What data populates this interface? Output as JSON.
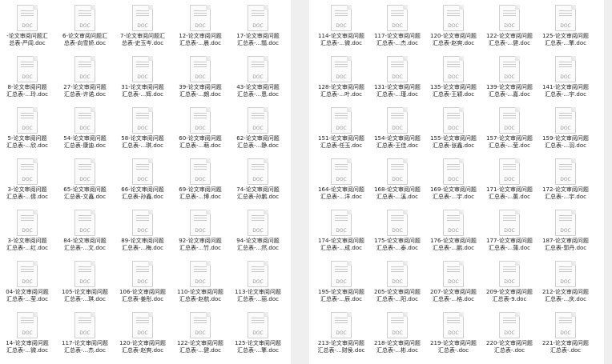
{
  "icon_tag": "DOC",
  "left_panel": {
    "items": [
      {
        "l1": "-论文审阅问题汇",
        "l2": "总表-严闾.doc"
      },
      {
        "l1": "6-论文审阅问题汇",
        "l2": "总表-向雪娇.doc"
      },
      {
        "l1": "7-论文审阅问题汇",
        "l2": "总表-史玉岑.doc"
      },
      {
        "l1": "12-论文审阅问题",
        "l2": "汇总表-...晨.doc"
      },
      {
        "l1": "17-论文审阅问题",
        "l2": "汇总表-...瓢.doc"
      },
      {
        "l1": "8-论文审阅问题",
        "l2": "汇总表-...玲.doc"
      },
      {
        "l1": "27-论文审阅问题",
        "l2": "汇总表-许诺.doc"
      },
      {
        "l1": "31-论文审阅问题",
        "l2": "汇总表-...辉.doc"
      },
      {
        "l1": "39-论文审阅问题",
        "l2": "汇总表-...朗.doc"
      },
      {
        "l1": "43-论文审阅问题",
        "l2": "汇总表-...恩.doc"
      },
      {
        "l1": "5-论文审阅问题",
        "l2": "汇总表-...欣.doc"
      },
      {
        "l1": "54-论文审阅问题",
        "l2": "汇总表-康迪.doc"
      },
      {
        "l1": "58-论文审阅问题",
        "l2": "汇总表-...琪.doc"
      },
      {
        "l1": "60-论文审阅问题",
        "l2": "汇总表-...萌.doc"
      },
      {
        "l1": "62-论文审阅问题",
        "l2": "汇总表-...静.doc"
      },
      {
        "l1": "3-论文审阅问题",
        "l2": "汇总表-...倩.doc"
      },
      {
        "l1": "65-论文审阅问题",
        "l2": "汇总表-文鑫.doc"
      },
      {
        "l1": "66-论文审阅问题",
        "l2": "汇总表-孙鑫.doc"
      },
      {
        "l1": "69-论文审阅问题",
        "l2": "汇总表-...博.doc"
      },
      {
        "l1": "74-论文审阅问题",
        "l2": "汇总表-孙鹏.doc"
      },
      {
        "l1": "3-论文审阅问题",
        "l2": "汇总表-...红.doc"
      },
      {
        "l1": "84-论文审阅问题",
        "l2": "汇总表-...文.doc"
      },
      {
        "l1": "89-论文审阅问题",
        "l2": "汇总表-...梅.doc"
      },
      {
        "l1": "92-论文审阅问题",
        "l2": "汇总表-...竹.doc"
      },
      {
        "l1": "94-论文审阅问题",
        "l2": "汇总表-...然.doc"
      },
      {
        "l1": "04-论文审阅问题",
        "l2": "汇总表-...莹.doc"
      },
      {
        "l1": "105-论文审阅问题",
        "l2": "汇总表-...琪.doc"
      },
      {
        "l1": "106-论文审阅问题",
        "l2": "汇总表-姜彤.doc"
      },
      {
        "l1": "110-论文审阅问题",
        "l2": "汇总表-赵航.doc"
      },
      {
        "l1": "113-论文审阅问题",
        "l2": "汇总表-...丽.doc"
      },
      {
        "l1": "14-论文审阅问题",
        "l2": "汇总表-...微.doc"
      },
      {
        "l1": "117-论文审阅问题",
        "l2": "汇总表-...杰.doc"
      },
      {
        "l1": "120-论文审阅问题",
        "l2": "汇总表-赵爽.doc"
      },
      {
        "l1": "122-论文审阅问题",
        "l2": "汇总表-...健.doc"
      },
      {
        "l1": "125-论文审阅问题",
        "l2": "汇总表-...擎.doc"
      }
    ]
  },
  "right_panel": {
    "items": [
      {
        "l1": "114-论文审阅问题",
        "l2": "汇总表-...微.doc"
      },
      {
        "l1": "117-论文审阅问题",
        "l2": "汇总表-...杰.doc"
      },
      {
        "l1": "120-论文审阅问题",
        "l2": "汇总表-赵爽.doc"
      },
      {
        "l1": "122-论文审阅问题",
        "l2": "汇总表-...健.doc"
      },
      {
        "l1": "125-论文审阅问题",
        "l2": "汇总表-...擎.doc"
      },
      {
        "l1": "128-论文审阅问题",
        "l2": "汇总表-...叶.doc"
      },
      {
        "l1": "131-论文审阅问题",
        "l2": "汇总表-...瑾.doc"
      },
      {
        "l1": "135-论文审阅问题",
        "l2": "汇总表-王颖.doc"
      },
      {
        "l1": "139-论文审阅问题",
        "l2": "汇总表-...嘉.doc"
      },
      {
        "l1": "141-论文审阅问题",
        "l2": "汇总表-...宇.doc"
      },
      {
        "l1": "151-论文审阅问题",
        "l2": "汇总表-任玉.doc"
      },
      {
        "l1": "154-论文审阅问题",
        "l2": "汇总表-王佳.doc"
      },
      {
        "l1": "155-论文审阅问题",
        "l2": "汇总表-张鑫.doc"
      },
      {
        "l1": "157-论文审阅问题",
        "l2": "汇总表-...莹.doc"
      },
      {
        "l1": "159-论文审阅问题",
        "l2": "汇总表-...羽.doc"
      },
      {
        "l1": "164-论文审阅问题",
        "l2": "汇总表-...洋.doc"
      },
      {
        "l1": "168-论文审阅问题",
        "l2": "汇总表-...溪.doc"
      },
      {
        "l1": "169-论文审阅问题",
        "l2": "汇总表-...宇.doc"
      },
      {
        "l1": "171-论文审阅问题",
        "l2": "汇总表-...蕙.doc"
      },
      {
        "l1": "172-论文审阅问题",
        "l2": "汇总表-...宇.doc"
      },
      {
        "l1": "174-论文审阅问题",
        "l2": "汇总表-...成.doc"
      },
      {
        "l1": "175-论文审阅问题",
        "l2": "汇总表-...泰.doc"
      },
      {
        "l1": "176-论文审阅问题",
        "l2": "汇总表-...鹏.doc"
      },
      {
        "l1": "177-论文审阅问题",
        "l2": "汇总表-...蒲.doc"
      },
      {
        "l1": "187-论文审阅问题",
        "l2": "汇总表-郭丹.doc"
      },
      {
        "l1": "195-论文审阅问题",
        "l2": "汇总表-...辰.doc"
      },
      {
        "l1": "205-论文审阅问题",
        "l2": "汇总表-...阳.doc"
      },
      {
        "l1": "207-论文审阅问题",
        "l2": "汇总表-...格.doc"
      },
      {
        "l1": "209-论文审阅问题",
        "l2": "汇总表-9.doc"
      },
      {
        "l1": "212-论文审阅问题",
        "l2": "汇总表-...庆.doc"
      },
      {
        "l1": "213-论文审阅问题",
        "l2": "汇总表-...财侯.doc"
      },
      {
        "l1": "218-论文审阅问题",
        "l2": "汇总表-...彬.doc"
      },
      {
        "l1": "219-论文审阅问题",
        "l2": "汇总表-.doc"
      },
      {
        "l1": "220-论文审阅问题",
        "l2": "汇总表-.doc"
      },
      {
        "l1": "221-论文审阅问题",
        "l2": "汇总表-.doc"
      }
    ]
  }
}
